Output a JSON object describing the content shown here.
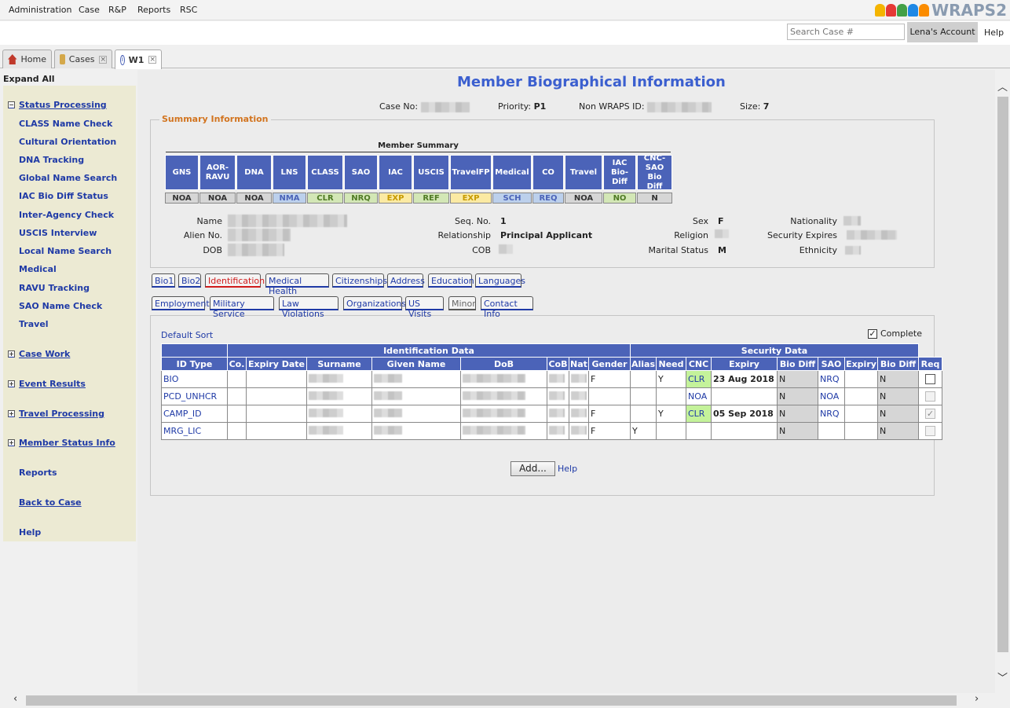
{
  "menu": [
    "Administration",
    "Case",
    "R&P",
    "Reports",
    "RSC"
  ],
  "logo": {
    "text": "WRAPS2",
    "colors": [
      "#f4b400",
      "#e53935",
      "#43a047",
      "#1e88e5",
      "#fb8c00"
    ]
  },
  "search": {
    "placeholder": "Search Case #"
  },
  "account": "Lena's Account",
  "help": "Help",
  "tabs": [
    {
      "label": "Home"
    },
    {
      "label": "Cases"
    },
    {
      "label": "W1"
    }
  ],
  "expand_all": "Expand All",
  "nav": {
    "status_processing": "Status Processing",
    "items": [
      "CLASS Name Check",
      "Cultural Orientation",
      "DNA Tracking",
      "Global Name Search",
      "IAC Bio Diff Status",
      "Inter-Agency Check",
      "USCIS Interview",
      "Local Name Search",
      "Medical",
      "RAVU Tracking",
      "SAO Name Check",
      "Travel"
    ],
    "case_work": "Case Work",
    "event_results": "Event Results",
    "travel_processing": "Travel Processing",
    "member_status_info": "Member Status Info",
    "reports": "Reports",
    "back_to_case": "Back to Case",
    "help": "Help"
  },
  "page_title": "Member Biographical Information",
  "header": {
    "case_no_label": "Case No:",
    "priority_label": "Priority:",
    "priority": "P1",
    "non_wraps_label": "Non WRAPS ID:",
    "size_label": "Size:",
    "size": "7"
  },
  "summary": {
    "legend": "Summary Information",
    "member_summary": "Member Summary",
    "columns": [
      {
        "h": "GNS",
        "s": "NOA",
        "c": "#d6d6d6",
        "t": "#333"
      },
      {
        "h": "AOR-\nRAVU",
        "s": "NOA",
        "c": "#d6d6d6",
        "t": "#333"
      },
      {
        "h": "DNA",
        "s": "NOA",
        "c": "#d6d6d6",
        "t": "#333"
      },
      {
        "h": "LNS",
        "s": "NMA",
        "c": "#bcd0ec",
        "t": "#4b63b8"
      },
      {
        "h": "CLASS",
        "s": "CLR",
        "c": "#d3e7b6",
        "t": "#4f7a24"
      },
      {
        "h": "SAO",
        "s": "NRQ",
        "c": "#d3e7b6",
        "t": "#4f7a24"
      },
      {
        "h": "IAC",
        "s": "EXP",
        "c": "#fbeaa3",
        "t": "#c79a00"
      },
      {
        "h": "USCIS",
        "s": "REF",
        "c": "#d3e7b6",
        "t": "#4f7a24"
      },
      {
        "h": "TravelFP",
        "s": "EXP",
        "c": "#fbeaa3",
        "t": "#c79a00"
      },
      {
        "h": "Medical",
        "s": "SCH",
        "c": "#bcd0ec",
        "t": "#4b63b8"
      },
      {
        "h": "CO",
        "s": "REQ",
        "c": "#bcd0ec",
        "t": "#4b63b8"
      },
      {
        "h": "Travel",
        "s": "NOA",
        "c": "#d6d6d6",
        "t": "#333"
      },
      {
        "h": "IAC\nBio-Diff",
        "s": "NO",
        "c": "#d3e7b6",
        "t": "#4f7a24"
      },
      {
        "h": "CNC-\nSAO Bio\nDiff",
        "s": "N",
        "c": "#d6d6d6",
        "t": "#333"
      }
    ],
    "labels": {
      "name": "Name",
      "alien": "Alien No.",
      "dob": "DOB",
      "seq": "Seq. No.",
      "rel": "Relationship",
      "cob": "COB",
      "sex": "Sex",
      "religion": "Religion",
      "marital": "Marital Status",
      "nationality": "Nationality",
      "sec_exp": "Security Expires",
      "ethnicity": "Ethnicity"
    },
    "values": {
      "seq": "1",
      "rel": "Principal Applicant",
      "sex": "F",
      "marital": "M"
    }
  },
  "subtabs_row1": [
    "Bio1",
    "Bio2",
    "Identification",
    "Medical Health",
    "Citizenships",
    "Address",
    "Education",
    "Languages"
  ],
  "subtabs_row2": [
    "Employment",
    "Military Service",
    "Law Violations",
    "Organizations",
    "US Visits",
    "Minor",
    "Contact Info"
  ],
  "default_sort": "Default Sort",
  "complete_label": "Complete",
  "table": {
    "group1": "Identification Data",
    "group2": "Security Data",
    "headers": [
      "ID Type",
      "Co.",
      "Expiry Date",
      "Surname",
      "Given Name",
      "DoB",
      "CoB",
      "Nat",
      "Gender",
      "Alias",
      "Need",
      "CNC",
      "Expiry",
      "Bio Diff",
      "SAO",
      "Expiry",
      "Bio Diff",
      "Req"
    ],
    "rows": [
      {
        "id": "BIO",
        "gender": "F",
        "alias": "",
        "need": "Y",
        "cnc": "CLR",
        "cnc_exp": "23 Aug 2018",
        "biodiff": "N",
        "sao": "NRQ",
        "sao_exp": "",
        "biodiff2": "N",
        "req": "unchecked"
      },
      {
        "id": "PCD_UNHCR",
        "gender": "",
        "alias": "",
        "need": "",
        "cnc": "NOA",
        "cnc_exp": "",
        "biodiff": "N",
        "sao": "NOA",
        "sao_exp": "",
        "biodiff2": "N",
        "req": "disabled"
      },
      {
        "id": "CAMP_ID",
        "gender": "F",
        "alias": "",
        "need": "Y",
        "cnc": "CLR",
        "cnc_exp": "05 Sep 2018",
        "biodiff": "N",
        "sao": "NRQ",
        "sao_exp": "",
        "biodiff2": "N",
        "req": "checked"
      },
      {
        "id": "MRG_LIC",
        "gender": "F",
        "alias": "Y",
        "need": "",
        "cnc": "",
        "cnc_exp": "",
        "biodiff": "N",
        "sao": "",
        "sao_exp": "",
        "biodiff2": "N",
        "req": "disabled"
      }
    ]
  },
  "add_label": "Add...",
  "add_help": "Help"
}
